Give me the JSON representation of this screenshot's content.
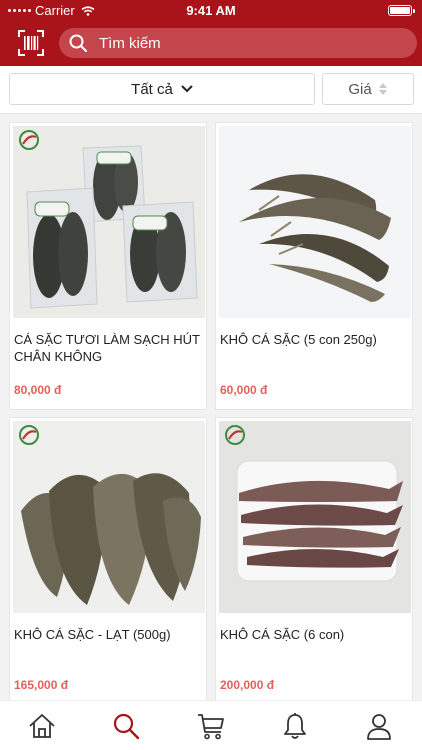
{
  "status_bar": {
    "carrier": "Carrier",
    "time": "9:41 AM"
  },
  "search": {
    "placeholder": "Tìm kiếm"
  },
  "filter": {
    "category_label": "Tất cả",
    "sort_label": "Giá"
  },
  "products": [
    {
      "name": "CÁ SẶC TƯƠI LÀM SẠCH HÚT CHÂN KHÔNG",
      "price": "80,000 đ"
    },
    {
      "name": "KHÔ CÁ SẶC (5 con 250g)",
      "price": "60,000 đ"
    },
    {
      "name": "KHÔ CÁ SẶC - LẠT (500g)",
      "price": "165,000 đ"
    },
    {
      "name": "KHÔ CÁ SẶC (6 con)",
      "price": "200,000 đ"
    }
  ],
  "tabs": [
    "home-icon",
    "search-icon",
    "cart-icon",
    "bell-icon",
    "user-icon"
  ],
  "colors": {
    "brand": "#a8141a",
    "search_bg": "#c4454b",
    "price": "#e4605a",
    "active_tab": "#a8141a"
  }
}
